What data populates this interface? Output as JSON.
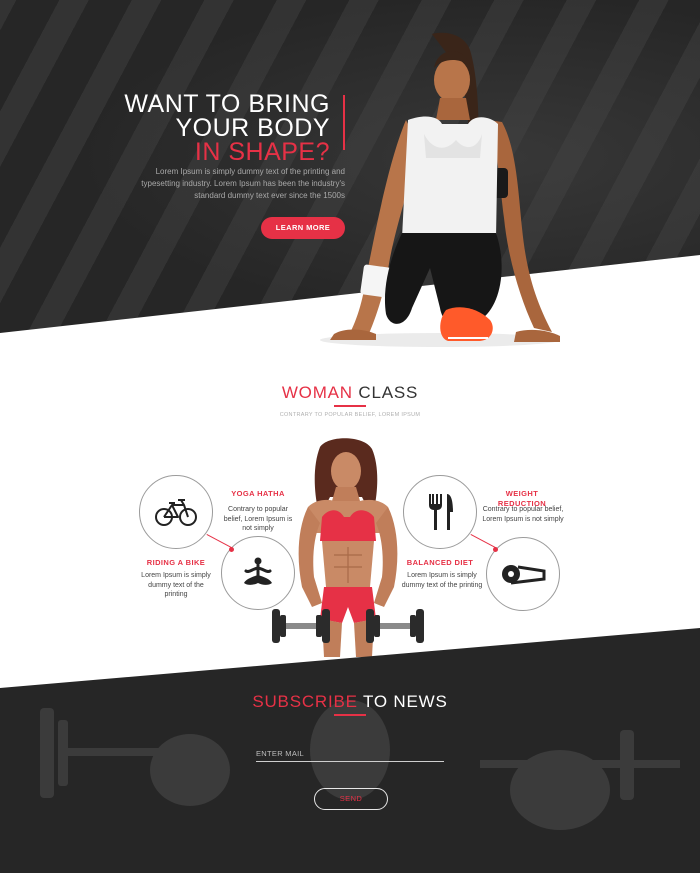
{
  "hero": {
    "title_line1": "WANT TO BRING",
    "title_line2": "YOUR BODY",
    "title_line3": "IN SHAPE?",
    "description": "Lorem Ipsum is simply dummy text of the printing and typesetting industry. Lorem Ipsum has been the industry's standard dummy text ever since the 1500s",
    "button_label": "LEARN MORE"
  },
  "woman_class": {
    "title_red": "WOMAN",
    "title_dark": " CLASS",
    "subtitle": "CONTRARY TO POPULAR BELIEF, LOREM IPSUM",
    "features": [
      {
        "title": "YOGA HATHA",
        "text": "Contrary to popular belief, Lorem Ipsum is not simply",
        "icon": "yoga-icon"
      },
      {
        "title": "RIDING A BIKE",
        "text": "Lorem Ipsum is simply dummy text of the printing",
        "icon": "bicycle-icon"
      },
      {
        "title": "WEIGHT REDUCTION",
        "text": "Contrary to popular belief, Lorem Ipsum is not simply",
        "icon": "measuring-tape-icon"
      },
      {
        "title": "BALANCED DIET",
        "text": "Lorem Ipsum is simply dummy text of the printing",
        "icon": "fork-knife-icon"
      }
    ]
  },
  "subscribe": {
    "title_red": "SUBSCRIBE",
    "title_white": " TO NEWS",
    "email_placeholder": "ENTER MAIL",
    "button_label": "SEND"
  },
  "colors": {
    "accent": "#e63146",
    "dark": "#262626"
  }
}
